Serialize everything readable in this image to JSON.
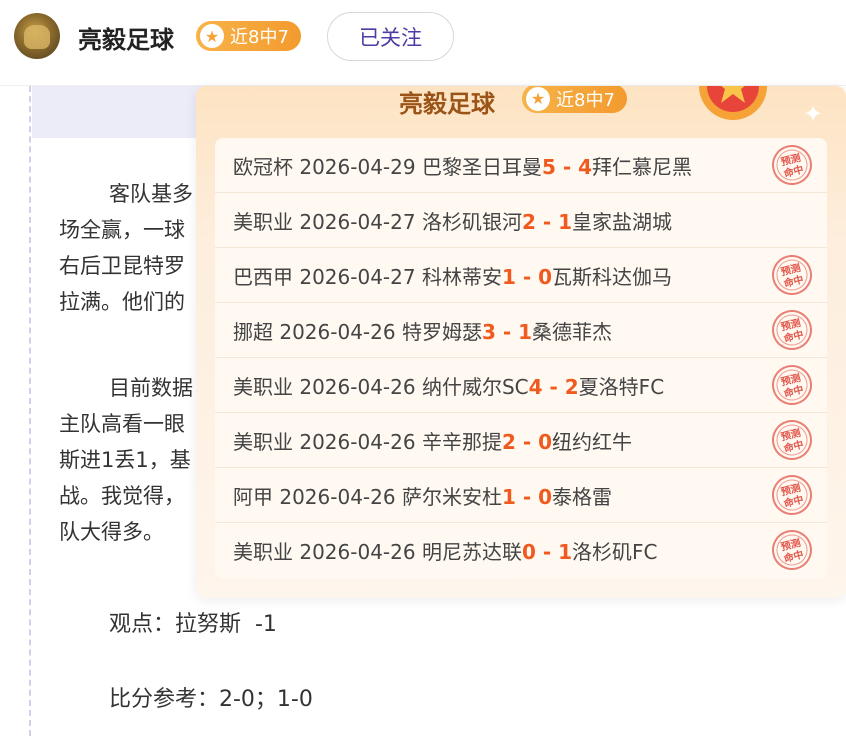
{
  "header": {
    "author": "亮毅足球",
    "badge": "近8中7",
    "follow_label": "已关注"
  },
  "article": {
    "para1": [
      "客队基多",
      "场全赢，一球",
      "右后卫昆特罗",
      "拉满。他们的"
    ],
    "para2": [
      "目前数据",
      "主队高看一眼",
      "斯进1丢1，基",
      "战。我觉得，",
      "队大得多。"
    ],
    "view": "观点：拉努斯  -1",
    "score": "比分参考：2-0；1-0"
  },
  "popup": {
    "title": "亮毅足球",
    "badge": "近8中7",
    "stamp_text": "预测命中",
    "rows": [
      {
        "prefix": "欧冠杯 2026-04-29 巴黎圣日耳曼",
        "home": "5",
        "sep": " - ",
        "away": "4",
        "team2": "拜仁慕尼黑",
        "hit": true
      },
      {
        "prefix": "美职业 2026-04-27 洛杉矶银河",
        "home": "2",
        "sep": " - ",
        "away": "1",
        "team2": "皇家盐湖城",
        "hit": false
      },
      {
        "prefix": "巴西甲 2026-04-27 科林蒂安",
        "home": "1",
        "sep": " - ",
        "away": "0",
        "team2": "瓦斯科达伽马",
        "hit": true
      },
      {
        "prefix": "挪超 2026-04-26 特罗姆瑟",
        "home": "3",
        "sep": " - ",
        "away": "1",
        "team2": "桑德菲杰",
        "hit": true
      },
      {
        "prefix": "美职业 2026-04-26 纳什威尔SC",
        "home": "4",
        "sep": " - ",
        "away": "2",
        "team2": "夏洛特FC",
        "hit": true
      },
      {
        "prefix": "美职业 2026-04-26 辛辛那提",
        "home": "2",
        "sep": " - ",
        "away": "0",
        "team2": "纽约红牛",
        "hit": true
      },
      {
        "prefix": "阿甲 2026-04-26 萨尔米安杜",
        "home": "1",
        "sep": " - ",
        "away": "0",
        "team2": "泰格雷",
        "hit": true
      },
      {
        "prefix": "美职业 2026-04-26 明尼苏达联",
        "home": "0",
        "sep": " - ",
        "away": "1",
        "team2": "洛杉矶FC",
        "hit": true
      }
    ]
  },
  "colors": {
    "accent": "#f05a1f",
    "badge": "#f5a236",
    "follow_text": "#4f3aa6",
    "stamp": "#e2564a"
  }
}
